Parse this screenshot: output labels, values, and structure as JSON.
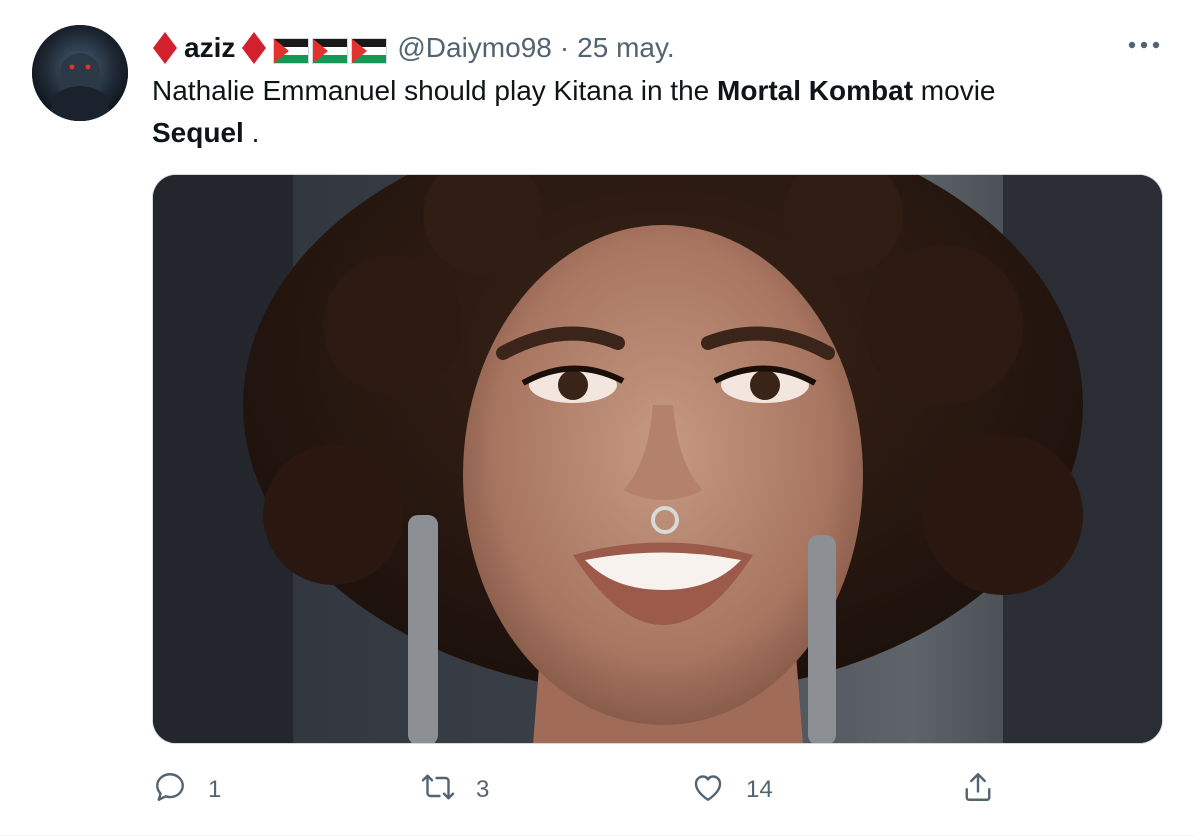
{
  "tweet": {
    "display_name": "aziz",
    "handle": "@Daiymo98",
    "separator": "·",
    "date": "25 may.",
    "text_part1": "Nathalie Emmanuel should play Kitana in the ",
    "text_bold1": "Mortal Kombat",
    "text_part2": " movie ",
    "text_bold2": "Sequel",
    "text_part3": " .",
    "media_alt": "Photo of a smiling woman with curly hair"
  },
  "actions": {
    "reply_count": "1",
    "retweet_count": "3",
    "like_count": "14"
  },
  "icons": {
    "diamond": "red-diamond-emoji",
    "flag": "palestine-flag-emoji",
    "more": "more-horizontal-icon",
    "reply": "reply-icon",
    "retweet": "retweet-icon",
    "like": "heart-icon",
    "share": "share-icon"
  },
  "colors": {
    "text_primary": "#0f1419",
    "text_secondary": "#536471",
    "diamond_red": "#d2202f",
    "flag_green": "#149954",
    "flag_red": "#e4312b"
  }
}
